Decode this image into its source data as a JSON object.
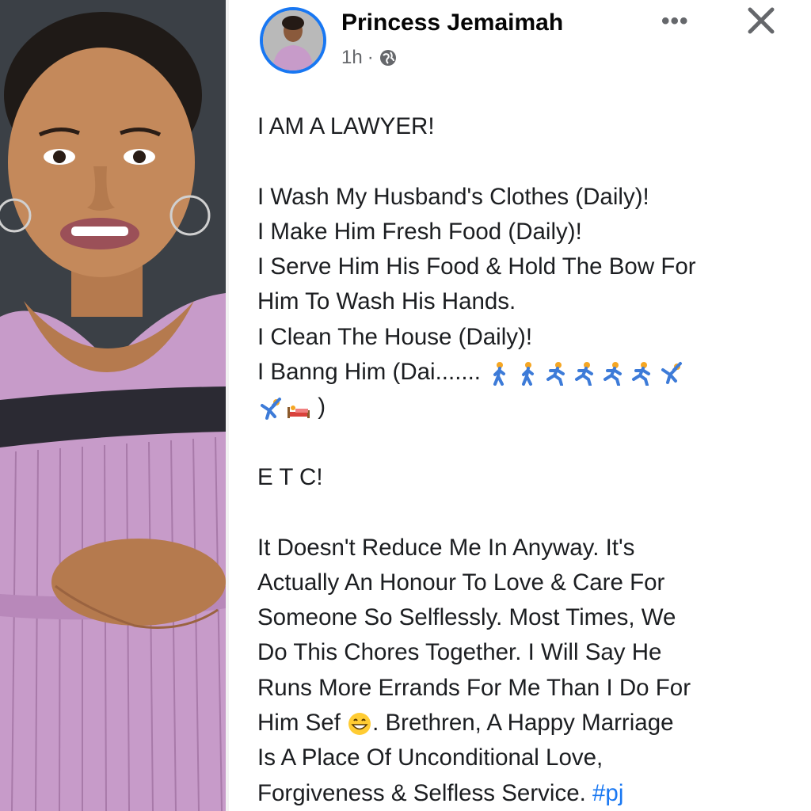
{
  "post": {
    "author": "Princess Jemaimah",
    "time": "1h",
    "separator": "·",
    "privacy_icon": "globe-icon",
    "more_label": "•••",
    "close_icon": "close-icon",
    "lines": {
      "l1": "I AM A LAWYER!",
      "l2": "I Wash My Husband's Clothes (Daily)!",
      "l3": "I Make Him Fresh Food (Daily)!",
      "l4": "I Serve Him His Food & Hold The Bow For",
      "l5": "Him To Wash His Hands.",
      "l6": "I Clean The House (Daily)!",
      "l7": "I Banng Him (Dai.......",
      "l8_end": ")",
      "l9": "E T C!",
      "p1": "It Doesn't Reduce Me In Anyway. It's",
      "p2": "Actually An Honour To Love & Care For",
      "p3": "Someone So Selflessly. Most Times, We",
      "p4": "Do This Chores Together. I Will Say He",
      "p5": "Runs More Errands For Me Than I Do For",
      "p6a": "Him Sef ",
      "p6b": ". Brethren, A Happy Marriage",
      "p7": "Is A Place Of Unconditional Love,",
      "p8a": "Forgiveness & Selfless Service. ",
      "hashtag": "#pj"
    }
  },
  "colors": {
    "accent": "#1877f2",
    "text": "#1c1e21",
    "muted": "#65676b",
    "dress": "#c79bc9"
  }
}
